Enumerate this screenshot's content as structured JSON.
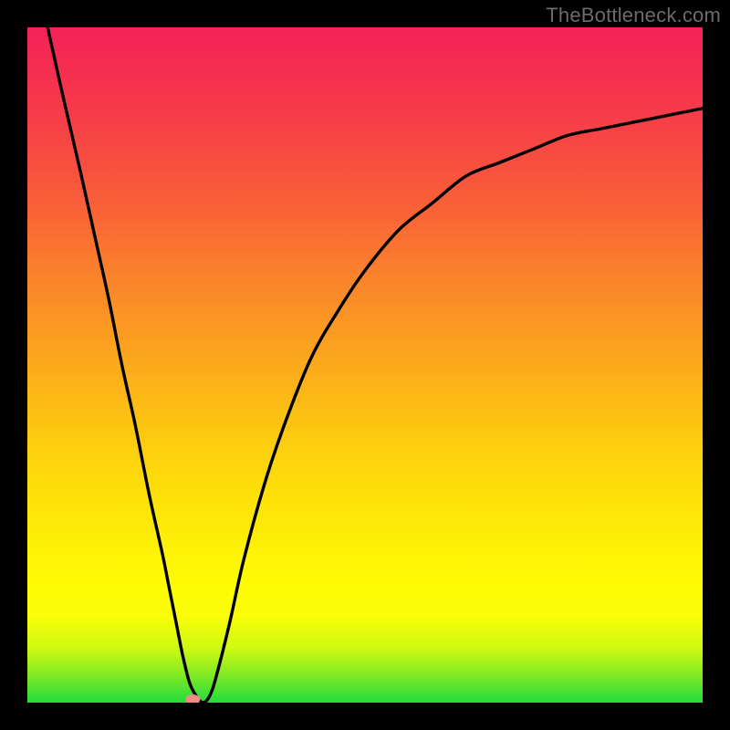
{
  "watermark": "TheBottleneck.com",
  "chart_data": {
    "type": "line",
    "title": "",
    "xlabel": "",
    "ylabel": "",
    "xlim": [
      0,
      100
    ],
    "ylim": [
      0,
      100
    ],
    "x": [
      3,
      5,
      8,
      10,
      12,
      14,
      16,
      18,
      20,
      21,
      22,
      23,
      24,
      25,
      26,
      27,
      28,
      30,
      32,
      35,
      38,
      42,
      46,
      50,
      55,
      60,
      65,
      70,
      75,
      80,
      85,
      90,
      95,
      100
    ],
    "values": [
      100,
      91,
      78,
      69,
      60,
      50,
      41,
      31,
      22,
      17,
      12,
      7,
      3,
      1,
      0,
      1,
      4,
      12,
      21,
      32,
      41,
      51,
      58,
      64,
      70,
      74,
      78,
      80,
      82,
      84,
      85,
      86,
      87,
      88
    ],
    "marker": {
      "x": 24.5,
      "y": 0.5,
      "color": "#f18c84",
      "size": 2
    },
    "gradient_colors_bottom_to_top": [
      "#22db3e",
      "#7eea24",
      "#cef912",
      "#fbfd06",
      "#fef107",
      "#fdce0f",
      "#fb9b21",
      "#f96536",
      "#f63a4a",
      "#f42258"
    ]
  }
}
